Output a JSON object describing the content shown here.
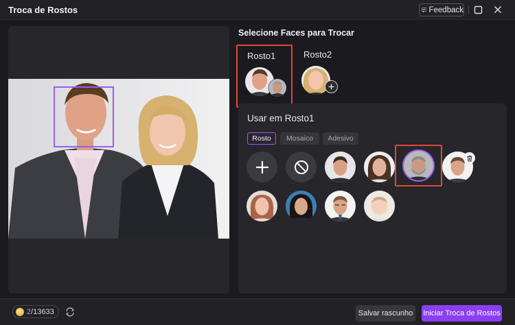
{
  "window": {
    "title": "Troca de Rostos"
  },
  "titlebar": {
    "feedback_label": "Feedback"
  },
  "main": {
    "section_title": "Selecione Faces para Trocar",
    "rostos": [
      {
        "label": "Rosto1",
        "selected": true
      },
      {
        "label": "Rosto2",
        "selected": false
      }
    ],
    "usar_title": "Usar em Rosto1",
    "tabs": [
      {
        "label": "Rosto",
        "active": true
      },
      {
        "label": "Mosaico",
        "active": false
      },
      {
        "label": "Adesivo",
        "active": false
      }
    ]
  },
  "footer": {
    "credits_current": "2",
    "credits_total": "/13633",
    "save_label": "Salvar rascunho",
    "start_label": "Iniciar Troca de Rostos"
  },
  "colors": {
    "accent": "#8b3ff0",
    "selection": "#e0463e",
    "face_box": "#9a5cf0"
  }
}
